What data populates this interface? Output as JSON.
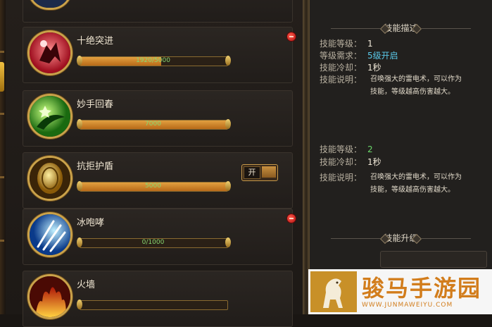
{
  "skills": [
    {
      "name": "十绝突进",
      "progress_text": "1920/5000",
      "progress": 0.55,
      "fill": "orange",
      "red_dot": true,
      "toggle": false
    },
    {
      "name": "妙手回春",
      "progress_text": "7000",
      "progress": 1.0,
      "fill": "orange",
      "red_dot": false,
      "toggle": false
    },
    {
      "name": "抗拒护盾",
      "progress_text": "5000",
      "progress": 1.0,
      "fill": "orange",
      "red_dot": false,
      "toggle": true,
      "toggle_label": "开"
    },
    {
      "name": "冰咆哮",
      "progress_text": "0/1000",
      "progress": 0.0,
      "fill": "grey",
      "red_dot": true,
      "toggle": false
    },
    {
      "name": "火墙",
      "progress_text": "",
      "progress": 0.0,
      "fill": "grey",
      "red_dot": false,
      "toggle": false
    }
  ],
  "description": {
    "title": "技能描述",
    "current": {
      "level_label": "技能等级：",
      "level": "1",
      "req_label": "等级需求：",
      "req": "5级开启",
      "cd_label": "技能冷却：",
      "cd": "1秒",
      "info_label": "技能说明：",
      "info_line1": "召唤强大的雷电术，可以作为",
      "info_line2": "技能，等级越高伤害越大。"
    },
    "next": {
      "level_label": "技能等级：",
      "level": "2",
      "cd_label": "技能冷却：",
      "cd": "1秒",
      "info_label": "技能说明：",
      "info_line1": "召唤强大的雷电术，可以作为",
      "info_line2": "技能，等级越高伤害越大。"
    },
    "upgrade_title": "技能升级"
  },
  "watermark": {
    "brand": "骏马手游园",
    "url": "WWW.JUNMAWEIYU.COM"
  },
  "colors": {
    "accent_gold": "#caa24a",
    "progress_orange": "#e2a040",
    "value_cyan": "#5ac8e8",
    "value_green": "#6ad86a",
    "watermark_orange": "#d27d1c"
  }
}
